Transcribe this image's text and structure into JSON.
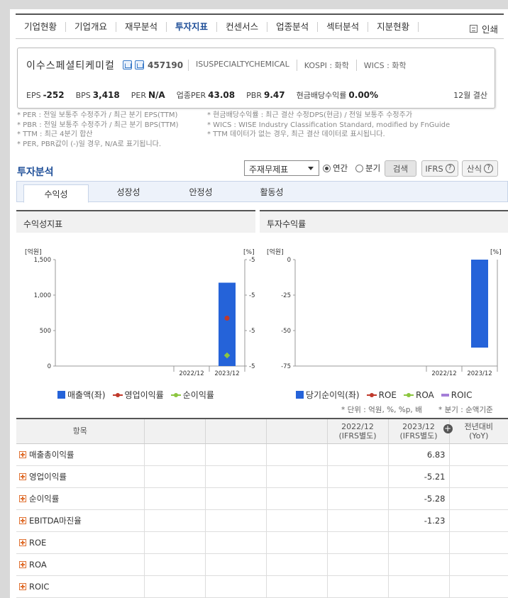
{
  "nav": {
    "tabs": [
      "기업현황",
      "기업개요",
      "재무분석",
      "투자지표",
      "컨센서스",
      "업종분석",
      "섹터분석",
      "지분현황"
    ],
    "active": "투자지표",
    "print_label": "인쇄"
  },
  "company": {
    "name": "이수스페셜티케미컬",
    "code": "457190",
    "english": "ISUSPECIALTYCHEMICAL",
    "market": "KOSPI : 화학",
    "wics": "WICS : 화학",
    "metrics": {
      "eps_label": "EPS",
      "eps": "-252",
      "bps_label": "BPS",
      "bps": "3,418",
      "per_label": "PER",
      "per": "N/A",
      "sector_per_label": "업종PER",
      "sector_per": "43.08",
      "pbr_label": "PBR",
      "pbr": "9.47",
      "div_label": "현금배당수익률",
      "div": "0.00%",
      "settle": "12월 결산"
    }
  },
  "notes": {
    "left": [
      "* PER : 전일 보통주 수정주가 / 최근 분기 EPS(TTM)",
      "* PBR : 전일 보통주 수정주가 / 최근 분기 BPS(TTM)",
      "* TTM : 최근 4분기 합산",
      "* PER, PBR값이 (-)일 경우, N/A로 표기됩니다."
    ],
    "right": [
      "* 현금배당수익률 : 최근 결산 수정DPS(현금) / 전일 보통주 수정주가",
      "* WICS : WISE Industry Classification Standard, modified by FnGuide",
      "* TTM 데이터가 없는 경우, 최근 결산 데이터로 표시됩니다."
    ]
  },
  "section": {
    "title": "투자분석",
    "select_value": "주재무제표",
    "radio_annual": "연간",
    "radio_quarter": "분기",
    "search_label": "검색",
    "ifrs_label": "IFRS",
    "calc_label": "산식",
    "help_glyph": "?"
  },
  "subtabs": [
    "수익성",
    "성장성",
    "안정성",
    "활동성"
  ],
  "colors": {
    "bar": "#2563d9",
    "red": "#c0392b",
    "green": "#8cc63f",
    "purple": "#a57fd8",
    "accent": "#1f4f98"
  },
  "chart_data": [
    {
      "type": "bar",
      "title": "수익성지표",
      "left_unit": "[억원]",
      "right_unit": "[%]",
      "left_ticks": [
        "1,500",
        "1,000",
        "500",
        "0"
      ],
      "right_ticks": [
        "-5",
        "-5",
        "-5",
        "-5"
      ],
      "ylim_left": [
        0,
        1500
      ],
      "ylim_right": [
        -5.3,
        -5.1
      ],
      "categories": [
        "2022/12",
        "2023/12"
      ],
      "series": [
        {
          "name": "매출액(좌)",
          "axis": "left",
          "kind": "bar",
          "values": [
            null,
            1175
          ]
        },
        {
          "name": "영업이익률",
          "axis": "right",
          "kind": "line",
          "values": [
            null,
            -5.21
          ]
        },
        {
          "name": "순이익률",
          "axis": "right",
          "kind": "line",
          "values": [
            null,
            -5.28
          ]
        }
      ]
    },
    {
      "type": "bar",
      "title": "투자수익률",
      "left_unit": "[억원]",
      "right_unit": "[%]",
      "left_ticks": [
        "0",
        "-25",
        "-50",
        "-75"
      ],
      "ylim_left": [
        -75,
        0
      ],
      "categories": [
        "2022/12",
        "2023/12"
      ],
      "series": [
        {
          "name": "당기순이익(좌)",
          "axis": "left",
          "kind": "bar",
          "values": [
            null,
            -62
          ]
        },
        {
          "name": "ROE",
          "axis": "right",
          "kind": "line",
          "values": [
            null,
            null
          ]
        },
        {
          "name": "ROA",
          "axis": "right",
          "kind": "line",
          "values": [
            null,
            null
          ]
        },
        {
          "name": "ROIC",
          "axis": "right",
          "kind": "line",
          "values": [
            null,
            null
          ]
        }
      ]
    }
  ],
  "table": {
    "unit_note": "* 단위 : 억원, %, %p, 배",
    "period_note": "* 분기 : 순액기준",
    "header_item": "항목",
    "col_2022": "2022/12",
    "col_2022_sub": "(IFRS별도)",
    "col_2023": "2023/12",
    "col_2023_sub": "(IFRS별도)",
    "col_yoy": "전년대비",
    "col_yoy_sub": "(YoY)",
    "rows": [
      {
        "label": "매출총이익률",
        "v2023": "6.83",
        "neg": false
      },
      {
        "label": "영업이익률",
        "v2023": "-5.21",
        "neg": true
      },
      {
        "label": "순이익률",
        "v2023": "-5.28",
        "neg": true
      },
      {
        "label": "EBITDA마진율",
        "v2023": "-1.23",
        "neg": true
      },
      {
        "label": "ROE",
        "v2023": "",
        "neg": false
      },
      {
        "label": "ROA",
        "v2023": "",
        "neg": false
      },
      {
        "label": "ROIC",
        "v2023": "",
        "neg": false
      }
    ]
  }
}
